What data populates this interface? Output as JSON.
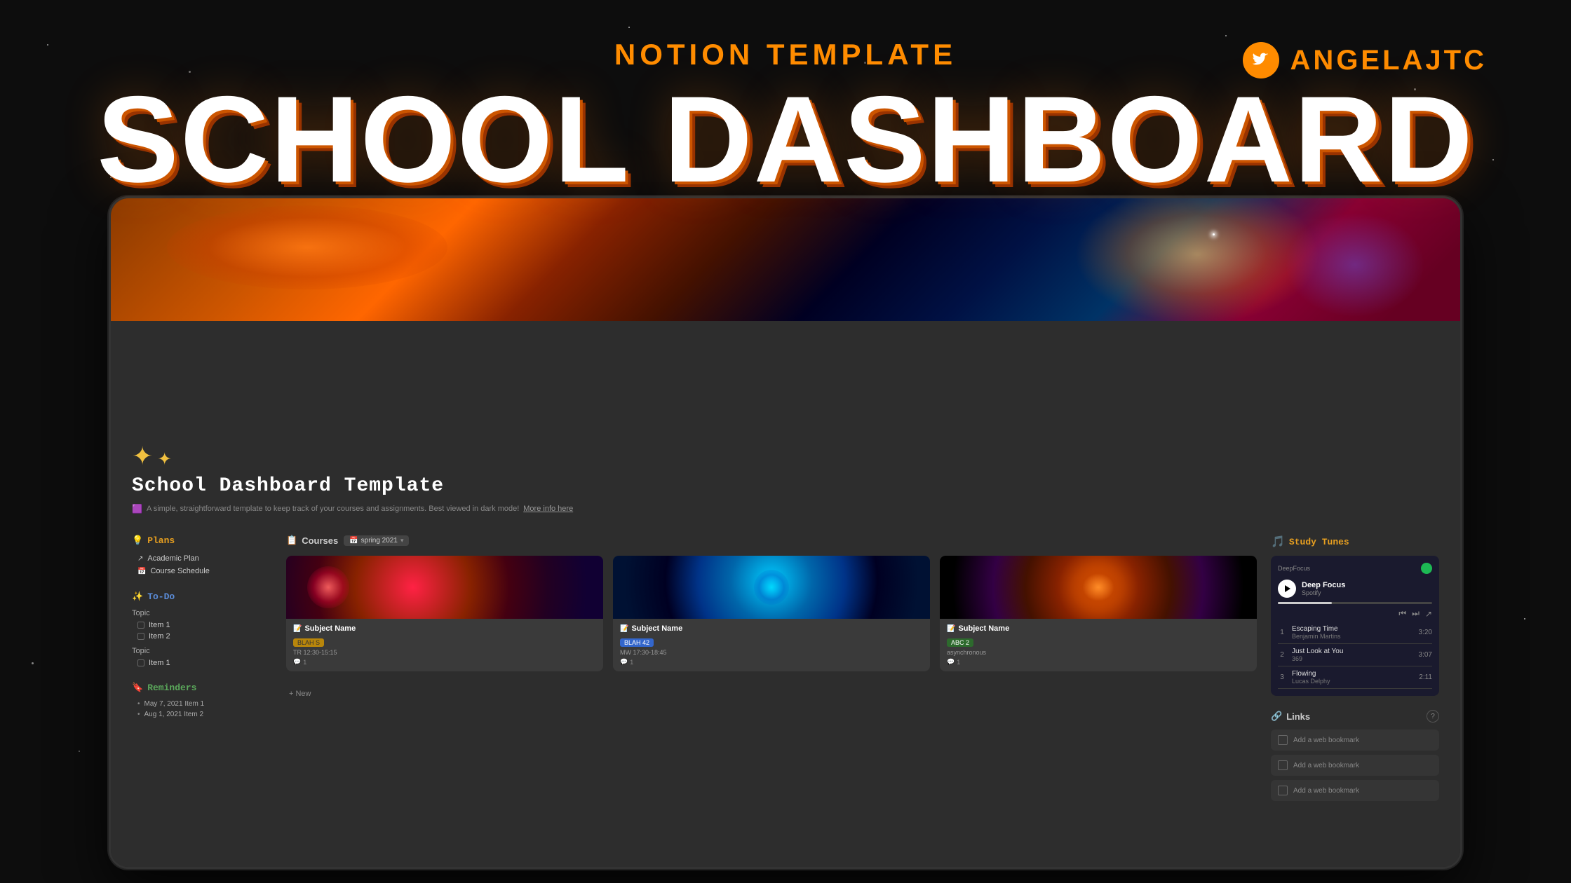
{
  "page": {
    "bg_color": "#0d0d0d"
  },
  "header": {
    "notion_template_label": "NOTION TEMPLATE",
    "title": "SCHOOL DASHBOARD",
    "twitter_handle": "ANGELAJTC"
  },
  "notion": {
    "page_title": "School Dashboard Template",
    "page_subtitle": "A simple, straightforward template to keep track of your courses and assignments. Best viewed in dark mode!",
    "subtitle_link": "More info here",
    "sparkle_emoji": "✦✦",
    "plans_section": {
      "label": "Plans",
      "icon": "💡",
      "items": [
        {
          "label": "Academic Plan",
          "icon": "↗"
        },
        {
          "label": "Course Schedule",
          "icon": "📅"
        }
      ]
    },
    "todo_section": {
      "label": "To-Do",
      "icon": "✨",
      "groups": [
        {
          "topic": "Topic",
          "items": [
            "Item 1",
            "Item 2"
          ]
        },
        {
          "topic": "Topic",
          "items": [
            "Item 1"
          ]
        }
      ]
    },
    "reminders_section": {
      "label": "Reminders",
      "icon": "🔖",
      "items": [
        "May 7, 2021  Item 1",
        "Aug 1, 2021  Item 2"
      ]
    },
    "courses_section": {
      "label": "Courses",
      "icon": "📋",
      "filter": "spring 2021",
      "cards": [
        {
          "name": "Subject Name",
          "emoji": "📝",
          "tag": "BLAH S",
          "tag_color": "yellow",
          "time": "TR 12:30-15:15",
          "comments": "1"
        },
        {
          "name": "Subject Name",
          "emoji": "📝",
          "tag": "BLAH 42",
          "tag_color": "blue",
          "time": "MW 17:30-18:45",
          "comments": "1"
        },
        {
          "name": "Subject Name",
          "emoji": "📝",
          "tag": "ABC 2",
          "tag_color": "green",
          "time": "asynchronous",
          "comments": "1"
        }
      ],
      "add_new_label": "+ New"
    },
    "study_tunes": {
      "label": "Study Tunes",
      "icon": "🎵",
      "player": {
        "playlist_name": "Deep Focus",
        "platform": "Spotify",
        "tracks": [
          {
            "num": "1",
            "title": "Escaping Time",
            "artist": "Benjamin Martins",
            "duration": "3:20"
          },
          {
            "num": "2",
            "title": "Just Look at You",
            "artist": "369",
            "duration": "3:07"
          },
          {
            "num": "3",
            "title": "Flowing",
            "artist": "Lucas Delphy",
            "duration": "2:11"
          }
        ]
      }
    },
    "links_section": {
      "label": "Links",
      "icon": "🔗",
      "bookmarks": [
        "Add a web bookmark",
        "Add a web bookmark",
        "Add a web bookmark"
      ]
    }
  }
}
